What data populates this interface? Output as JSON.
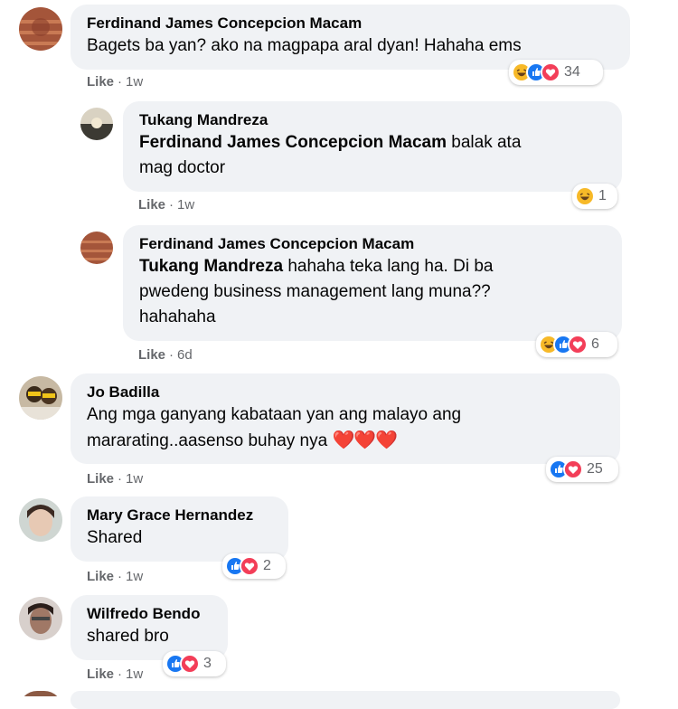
{
  "comments": [
    {
      "author": "Ferdinand James Concepcion Macam",
      "line1": "Bagets ba yan? ako na magpapa aral dyan! Hahaha ems",
      "like": "Like",
      "time": "1w",
      "reactions": [
        "haha",
        "like",
        "love"
      ],
      "count": "34"
    },
    {
      "author": "Tukang Mandreza",
      "mention": "Ferdinand James Concepcion Macam",
      "line1_rest": " balak ata",
      "line2": "mag doctor",
      "like": "Like",
      "time": "1w",
      "reactions": [
        "haha"
      ],
      "count": "1"
    },
    {
      "author": "Ferdinand James Concepcion Macam",
      "mention": "Tukang Mandreza",
      "line1_rest": " hahaha teka lang ha. Di ba",
      "line2": "pwedeng business management lang muna??",
      "line3": "hahahaha",
      "like": "Like",
      "time": "6d",
      "reactions": [
        "haha",
        "like",
        "love"
      ],
      "count": "6"
    },
    {
      "author": "Jo Badilla",
      "line1": "Ang mga ganyang kabataan yan ang malayo ang",
      "line2": "mararating..aasenso buhay nya",
      "emoji": "❤️❤️❤️",
      "like": "Like",
      "time": "1w",
      "reactions": [
        "like",
        "love"
      ],
      "count": "25"
    },
    {
      "author": "Mary Grace Hernandez",
      "line1": "Shared",
      "like": "Like",
      "time": "1w",
      "reactions": [
        "like",
        "love"
      ],
      "count": "2"
    },
    {
      "author": "Wilfredo Bendo",
      "line1": "shared bro",
      "like": "Like",
      "time": "1w",
      "reactions": [
        "like",
        "love"
      ],
      "count": "3"
    }
  ],
  "separator": "·",
  "colors": {
    "bubble": "#f0f2f5",
    "meta": "#65676b",
    "like_blue": "#1877f2",
    "love_red": "#f33e58",
    "haha_yellow": "#f7b928"
  },
  "icons": [
    "haha-reaction-icon",
    "like-reaction-icon",
    "love-reaction-icon"
  ]
}
